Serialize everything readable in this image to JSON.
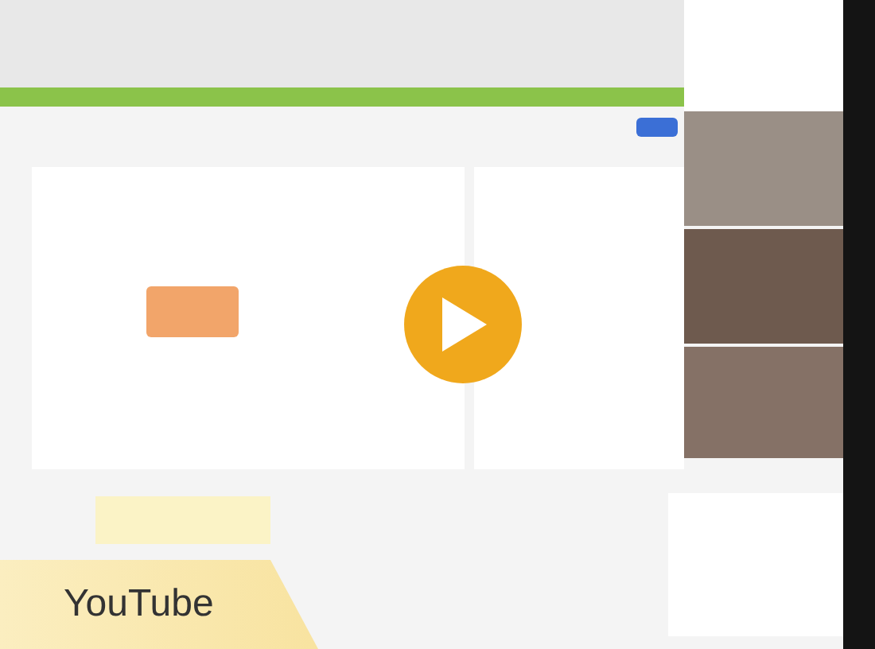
{
  "player": {
    "label": "YouTube"
  }
}
